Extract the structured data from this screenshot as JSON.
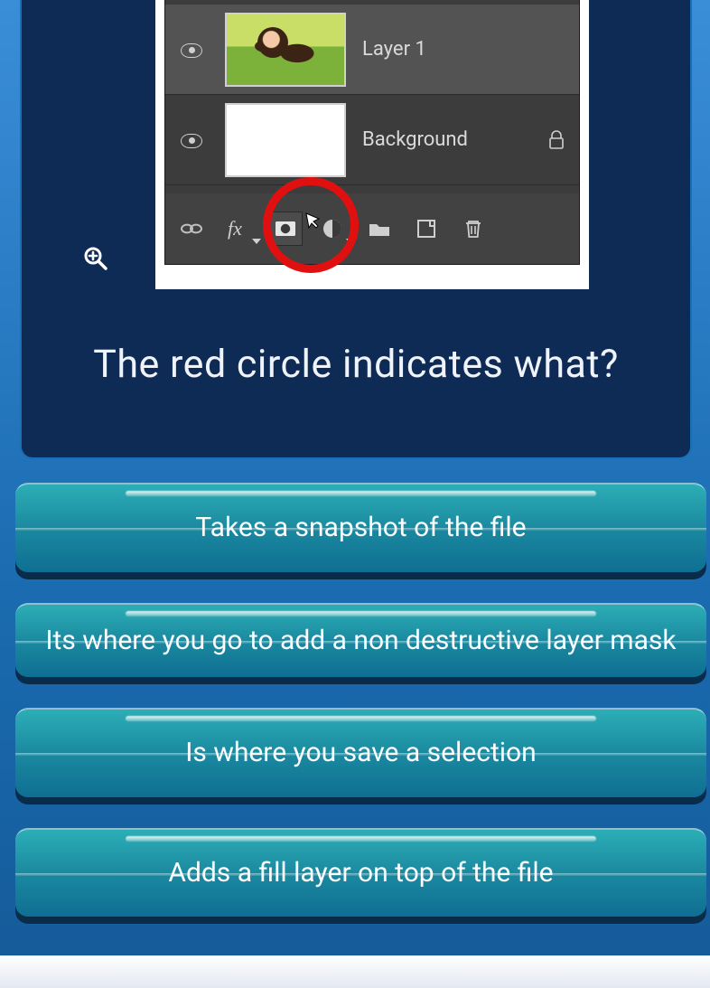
{
  "screenshot_panel": {
    "layers": [
      {
        "label": "Layer 1",
        "thumb": "photo",
        "locked": false
      },
      {
        "label": "Background",
        "thumb": "white",
        "locked": true
      }
    ],
    "bottom_icons": [
      {
        "name": "link-icon"
      },
      {
        "name": "fx-icon"
      },
      {
        "name": "mask-icon",
        "circled": true
      },
      {
        "name": "adjustment-icon"
      },
      {
        "name": "folder-icon"
      },
      {
        "name": "new-layer-icon"
      },
      {
        "name": "trash-icon"
      }
    ]
  },
  "question": "The red circle indicates what?",
  "answers": [
    "Takes a snapshot of the file",
    "Its where you go to add a non destructive layer mask",
    "Is where you save a selection",
    "Adds a fill layer on top of the file"
  ],
  "colors": {
    "ring": "#e11010"
  }
}
